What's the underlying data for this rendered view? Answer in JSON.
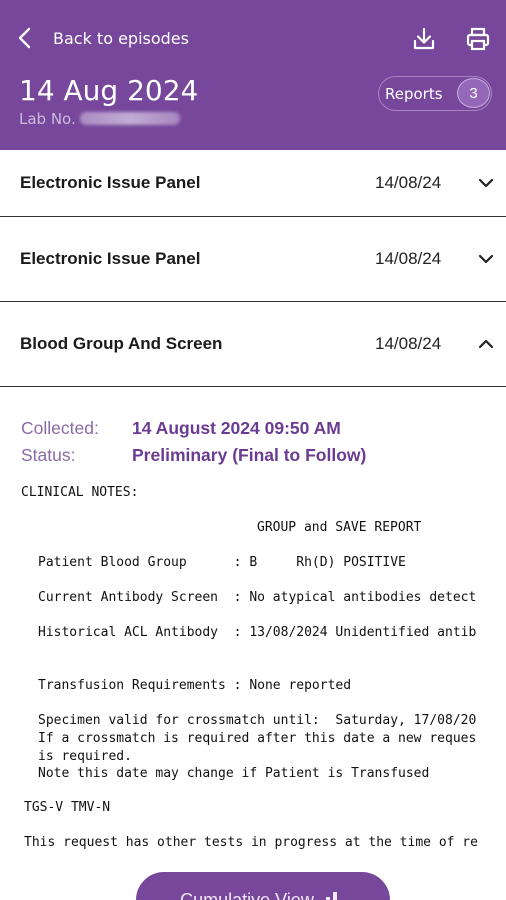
{
  "header": {
    "back_label": "Back to episodes",
    "date_title": "14 Aug 2024",
    "lab_no_label": "Lab No.",
    "reports_label": "Reports",
    "reports_count": "3"
  },
  "panels": [
    {
      "title": "Electronic Issue Panel",
      "date": "14/08/24",
      "expanded": false
    },
    {
      "title": "Electronic Issue Panel",
      "date": "14/08/24",
      "expanded": false
    },
    {
      "title": "Blood Group And Screen",
      "date": "14/08/24",
      "expanded": true
    }
  ],
  "detail": {
    "collected_label": "Collected:",
    "collected_value": "14 August 2024 09:50 AM",
    "status_label": "Status:",
    "status_value": "Preliminary (Final to Follow)",
    "clinical_notes_label": "CLINICAL NOTES:",
    "report_title": "GROUP and SAVE REPORT",
    "line_blood_group": "Patient Blood Group      : B     Rh(D) POSITIVE",
    "line_antibody": "Current Antibody Screen  : No atypical antibodies detect",
    "line_historical": "Historical ACL Antibody  : 13/08/2024 Unidentified antib",
    "line_transfusion": "Transfusion Requirements : None reported",
    "line_specimen_1": "Specimen valid for crossmatch until:  Saturday, 17/08/20",
    "line_specimen_2": "If a crossmatch is required after this date a new reques",
    "line_specimen_3": "is required.",
    "line_specimen_4": "Note this date may change if Patient is Transfused",
    "line_tgs": "TGS-V TMV-N",
    "line_request": "This request has other tests in progress at the time of re"
  },
  "footer": {
    "cumulative_label": "Cumulative View"
  },
  "colors": {
    "brand_purple": "#76479b",
    "label_purple": "#8a6aa8",
    "value_purple": "#6b3b93"
  },
  "icons": [
    "chevron-left-icon",
    "download-icon",
    "print-icon",
    "chevron-down-icon",
    "chevron-up-icon",
    "bar-chart-icon"
  ]
}
